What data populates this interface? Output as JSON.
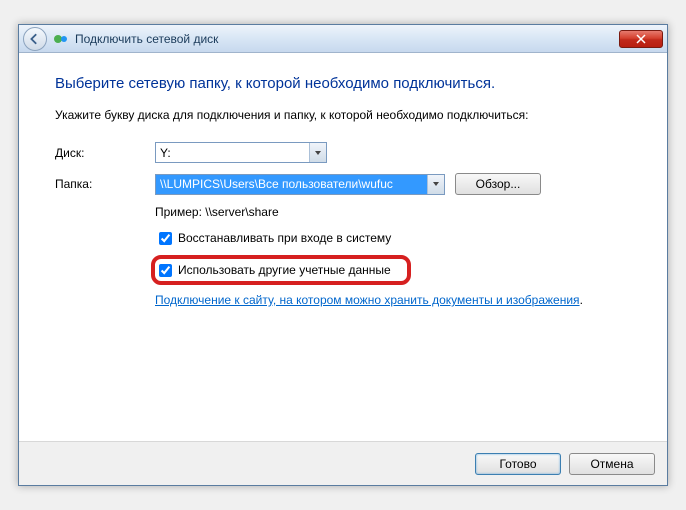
{
  "titlebar": {
    "title": "Подключить сетевой диск"
  },
  "content": {
    "heading": "Выберите сетевую папку, к которой необходимо подключиться.",
    "instruction": "Укажите букву диска для подключения и папку, к которой необходимо подключиться:",
    "drive_label": "Диск:",
    "drive_value": "Y:",
    "folder_label": "Папка:",
    "folder_value": "\\\\LUMPICS\\Users\\Все пользователи\\wufuc",
    "browse_label": "Обзор...",
    "example": "Пример: \\\\server\\share",
    "reconnect_label": "Восстанавливать при входе в систему",
    "reconnect_checked": true,
    "different_creds_label": "Использовать другие учетные данные",
    "different_creds_checked": true,
    "link_text": "Подключение к сайту, на котором можно хранить документы и изображения",
    "link_period": "."
  },
  "footer": {
    "finish_label": "Готово",
    "cancel_label": "Отмена"
  }
}
